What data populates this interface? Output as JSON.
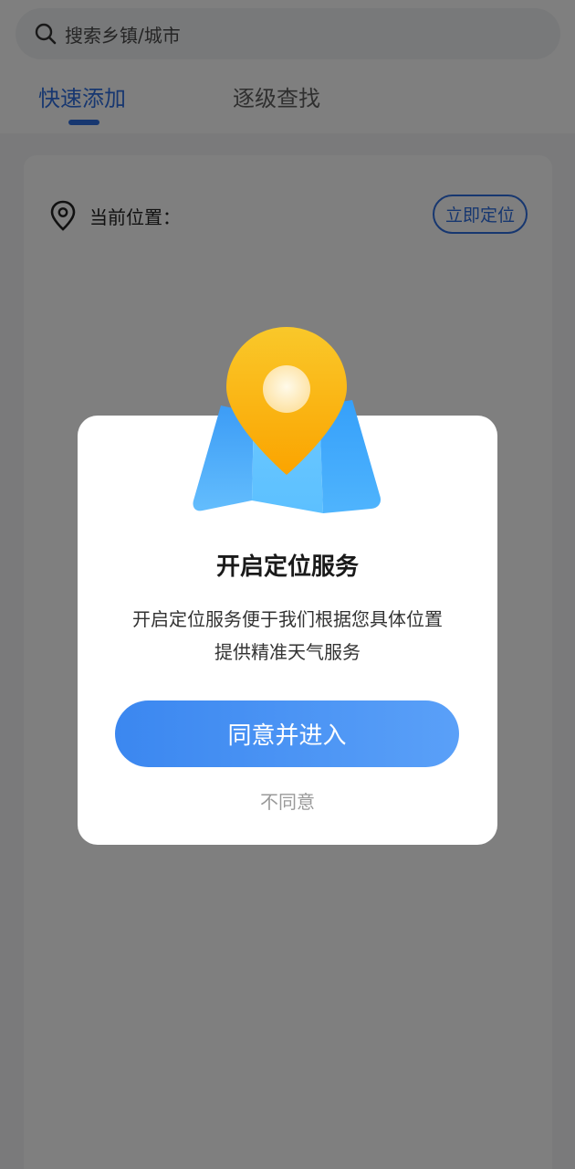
{
  "search": {
    "placeholder": "搜索乡镇/城市"
  },
  "tabs": [
    {
      "label": "快速添加",
      "active": true
    },
    {
      "label": "逐级查找",
      "active": false
    }
  ],
  "location": {
    "label": "当前位置：",
    "locate_button": "立即定位"
  },
  "dialog": {
    "title": "开启定位服务",
    "message_line1": "开启定位服务便于我们根据您具体位置",
    "message_line2": "提供精准天气服务",
    "agree_button": "同意并进入",
    "disagree_link": "不同意"
  },
  "icons": {
    "search": "search-icon",
    "location_pin": "location-pin-icon",
    "illustration": "map-pin-illustration"
  },
  "colors": {
    "accent": "#2f6fe0",
    "button_gradient_start": "#3b87f0",
    "button_gradient_end": "#5aa0f8",
    "pin_yellow": "#f9b400",
    "map_blue": "#4eb0fb"
  }
}
